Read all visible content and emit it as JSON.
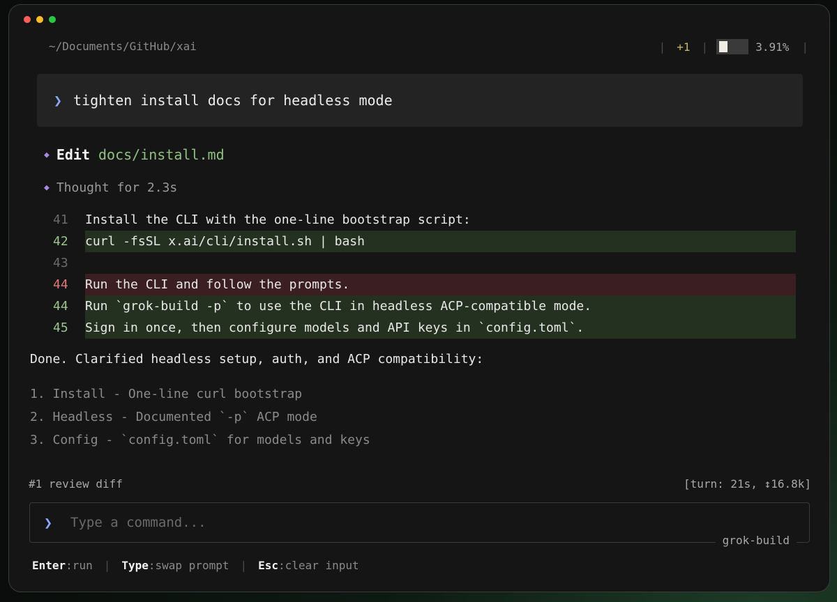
{
  "window": {
    "path": "~/Documents/GitHub/xai",
    "changes": "+1",
    "context_percent": "3.91%",
    "context_fraction": 0.0391
  },
  "prompt": {
    "chevron": "❯",
    "text": "tighten install docs for headless mode"
  },
  "edit": {
    "label": "Edit",
    "file": "docs/install.md"
  },
  "thought": "Thought for 2.3s",
  "diff": [
    {
      "line": "41",
      "type": "context",
      "text": "Install the CLI with the one-line bootstrap script:"
    },
    {
      "line": "42",
      "type": "add",
      "text": "curl -fsSL x.ai/cli/install.sh | bash"
    },
    {
      "line": "43",
      "type": "context",
      "text": ""
    },
    {
      "line": "44",
      "type": "del",
      "text": "Run the CLI and follow the prompts."
    },
    {
      "line": "44",
      "type": "add",
      "text": "Run `grok-build -p` to use the CLI in headless ACP-compatible mode."
    },
    {
      "line": "45",
      "type": "add",
      "text": "Sign in once, then configure models and API keys in `config.toml`."
    }
  ],
  "summary": "Done. Clarified headless setup, auth, and ACP compatibility:",
  "summary_list": [
    "1. Install - One-line curl bootstrap",
    "2. Headless - Documented `-p` ACP mode",
    "3. Config - `config.toml` for models and keys"
  ],
  "footer": {
    "left": "#1 review diff",
    "right": "[turn: 21s, ↕16.8k]"
  },
  "input": {
    "chevron": "❯",
    "placeholder": "Type a command...",
    "model": "grok-build"
  },
  "hints": [
    {
      "key": "Enter",
      "desc": ":run"
    },
    {
      "key": "Type",
      "desc": ":swap prompt"
    },
    {
      "key": "Esc",
      "desc": ":clear input"
    }
  ],
  "colors": {
    "accent": "#8aa8ff",
    "add_bg": "#253120",
    "del_bg": "#3a1e22",
    "file_green": "#8fc081",
    "diamond_purple": "#a58ae6"
  }
}
